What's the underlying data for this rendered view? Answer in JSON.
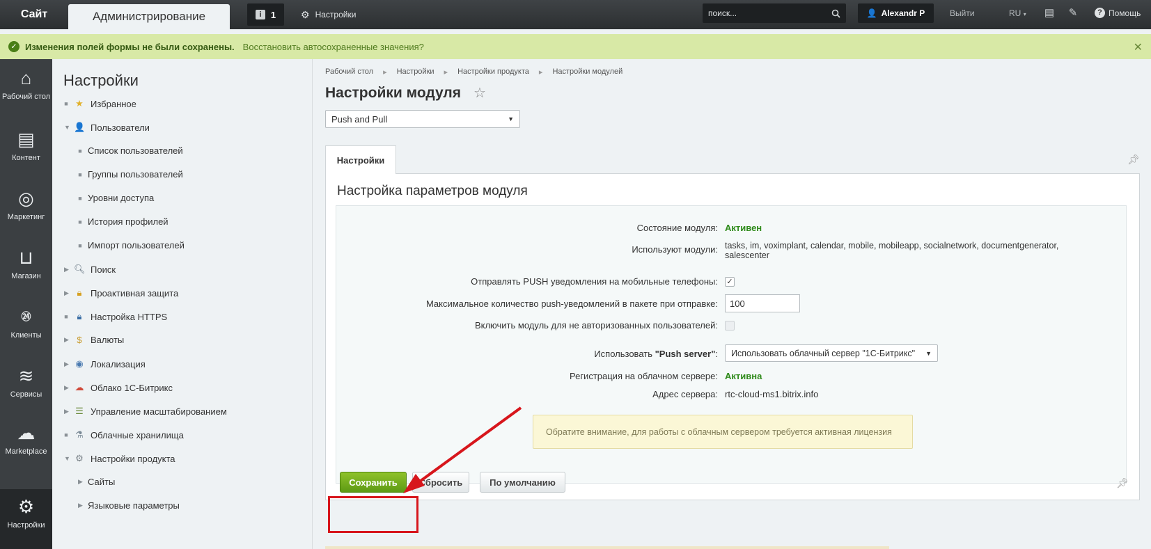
{
  "topbar": {
    "site_label": "Сайт",
    "admin_label": "Администрирование",
    "notifications_count": "1",
    "settings_label": "Настройки",
    "search_placeholder": "поиск...",
    "user_name": "Alexandr P",
    "logout_label": "Выйти",
    "lang_label": "RU",
    "help_label": "Помощь"
  },
  "warning": {
    "title": "Изменения полей формы не были сохранены.",
    "link": "Восстановить автосохраненные значения?"
  },
  "leftnav": [
    {
      "label": "Рабочий стол",
      "icon": "home-icon"
    },
    {
      "label": "Контент",
      "icon": "document-icon"
    },
    {
      "label": "Маркетинг",
      "icon": "target-icon"
    },
    {
      "label": "Магазин",
      "icon": "basket-icon"
    },
    {
      "label": "Клиенты",
      "icon": "crm-24-icon"
    },
    {
      "label": "Сервисы",
      "icon": "layers-icon"
    },
    {
      "label": "Marketplace",
      "icon": "cloud-download-icon"
    },
    {
      "label": "Настройки",
      "icon": "gear-icon"
    }
  ],
  "menu": {
    "title": "Настройки",
    "items": [
      {
        "label": "Избранное"
      },
      {
        "label": "Пользователи"
      },
      {
        "label": "Список пользователей"
      },
      {
        "label": "Группы пользователей"
      },
      {
        "label": "Уровни доступа"
      },
      {
        "label": "История профилей"
      },
      {
        "label": "Импорт пользователей"
      },
      {
        "label": "Поиск"
      },
      {
        "label": "Проактивная защита"
      },
      {
        "label": "Настройка HTTPS"
      },
      {
        "label": "Валюты"
      },
      {
        "label": "Локализация"
      },
      {
        "label": "Облако 1С-Битрикс"
      },
      {
        "label": "Управление масштабированием"
      },
      {
        "label": "Облачные хранилища"
      },
      {
        "label": "Настройки продукта"
      },
      {
        "label": "Сайты"
      },
      {
        "label": "Языковые параметры"
      }
    ]
  },
  "breadcrumbs": [
    "Рабочий стол",
    "Настройки",
    "Настройки продукта",
    "Настройки модулей"
  ],
  "page_title": "Настройки модуля",
  "module_select": "Push and Pull",
  "tab_label": "Настройки",
  "panel_title": "Настройка параметров модуля",
  "fields": {
    "state_label": "Состояние модуля:",
    "state_value": "Активен",
    "used_label": "Используют модули:",
    "used_value_line1": "tasks, im, voximplant, calendar, mobile, mobileapp, socialnetwork, documentgenerator,",
    "used_value_line2": "salescenter",
    "push_label": "Отправлять PUSH уведомления на мобильные телефоны:",
    "max_label": "Максимальное количество push-уведомлений в пакете при отправке:",
    "max_value": "100",
    "guest_label": "Включить модуль для не авторизованных пользователей:",
    "server_label_prefix": "Использовать ",
    "server_label_bold": "\"Push server\"",
    "server_label_suffix": ":",
    "server_value": "Использовать облачный сервер \"1С-Битрикс\"",
    "reg_label": "Регистрация на облачном сервере:",
    "reg_value": "Активна",
    "addr_label": "Адрес сервера:",
    "addr_value": "rtc-cloud-ms1.bitrix.info"
  },
  "notice": "Обратите внимание, для работы с облачным сервером требуется активная лицензия",
  "buttons": {
    "save": "Сохранить",
    "reset": "Сбросить",
    "default": "По умолчанию"
  },
  "colors": {
    "topbar": "#2c2f31",
    "warning_bg": "#d8e9a6",
    "save_green": "#6aa81a",
    "highlight_red": "#d7161c",
    "active_green": "#2e8a1a"
  }
}
